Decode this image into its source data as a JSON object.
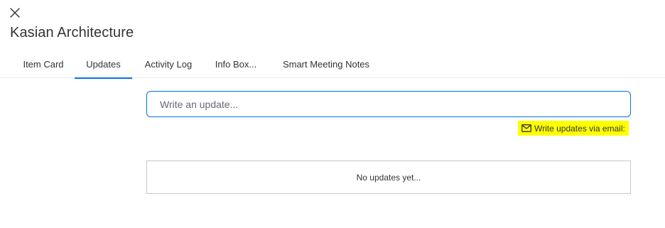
{
  "header": {
    "close_icon": "close-icon",
    "title": "Kasian Architecture"
  },
  "tabs": [
    {
      "label": "Item Card",
      "active": false
    },
    {
      "label": "Updates",
      "active": true
    },
    {
      "label": "Activity Log",
      "active": false
    },
    {
      "label": "Info Box...",
      "active": false
    },
    {
      "label": "Smart Meeting Notes",
      "active": false
    }
  ],
  "updates": {
    "input_placeholder": "Write an update...",
    "email_link_label": "Write updates via email:",
    "email_icon": "envelope-icon",
    "empty_message": "No updates yet..."
  },
  "colors": {
    "accent": "#0073ea",
    "highlight": "#ffff00",
    "text": "#323338"
  }
}
